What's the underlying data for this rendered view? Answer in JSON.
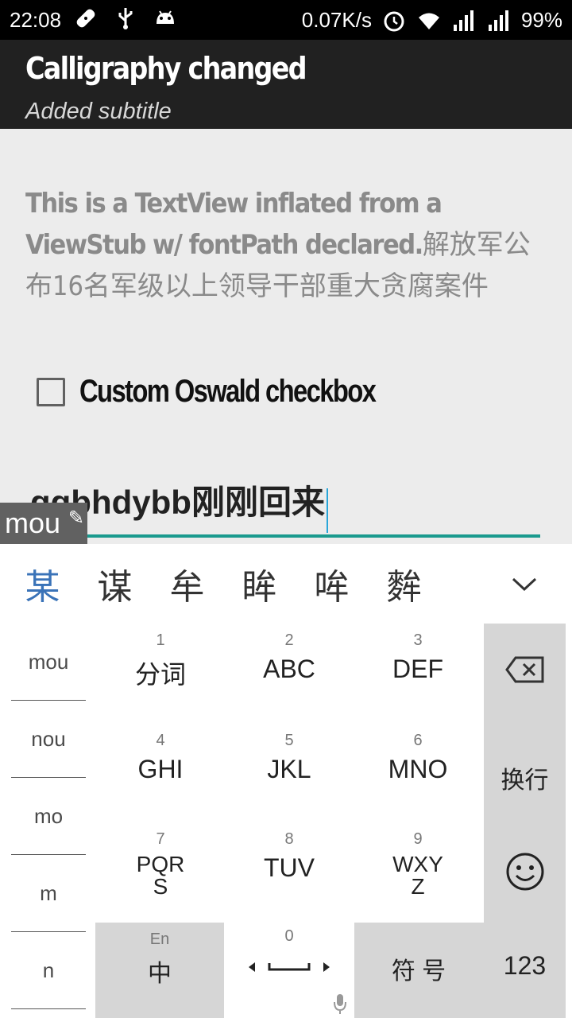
{
  "status_bar": {
    "time": "22:08",
    "network_speed": "0.07K/s",
    "battery": "99%"
  },
  "action_bar": {
    "title": "Calligraphy changed",
    "subtitle": "Added subtitle"
  },
  "content": {
    "text_latin": "This is a TextView inflated from a ViewStub w/ fontPath declared.",
    "text_cjk": "解放军公布16名军级以上领导干部重大贪腐案件",
    "checkbox_label": "Custom Oswald checkbox",
    "checkbox_checked": false,
    "edit_value": "ggbhdybb刚刚回来"
  },
  "ime": {
    "composing": "mou",
    "candidates": [
      "某",
      "谋",
      "牟",
      "眸",
      "哞",
      "麰"
    ],
    "pinyin_options": [
      "mou",
      "nou",
      "mo",
      "m",
      "n"
    ],
    "keys": [
      {
        "num": "1",
        "label": "分词"
      },
      {
        "num": "2",
        "label": "ABC"
      },
      {
        "num": "3",
        "label": "DEF"
      },
      {
        "num": "4",
        "label": "GHI"
      },
      {
        "num": "5",
        "label": "JKL"
      },
      {
        "num": "6",
        "label": "MNO"
      },
      {
        "num": "7",
        "label": "PQRS"
      },
      {
        "num": "8",
        "label": "TUV"
      },
      {
        "num": "9",
        "label": "WXYZ"
      }
    ],
    "enter_label": "换行",
    "lang_small": "En",
    "lang_big": "中",
    "zero": "0",
    "symbol_label": "符 号",
    "numbers_label": "123",
    "accent_color": "#3a73b8"
  }
}
